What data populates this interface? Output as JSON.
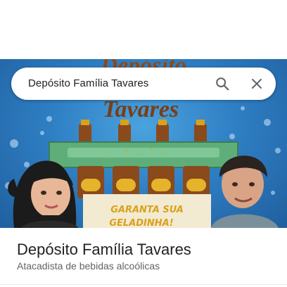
{
  "search": {
    "query": "Depósito Família Tavares",
    "search_icon": "search-icon",
    "close_icon": "close-icon"
  },
  "hero": {
    "banner_top": "Depósito",
    "banner_name": "Tavares",
    "slogan_line1": "GARANTA SUA",
    "slogan_line2": "GELADINHA!"
  },
  "place": {
    "title": "Depósito Família Tavares",
    "category": "Atacadista de bebidas alcoólicas"
  },
  "colors": {
    "water": "#2f7fc4",
    "crate": "#5fae7a",
    "bottle": "#8a4a1c",
    "slogan": "#d9a21b"
  }
}
